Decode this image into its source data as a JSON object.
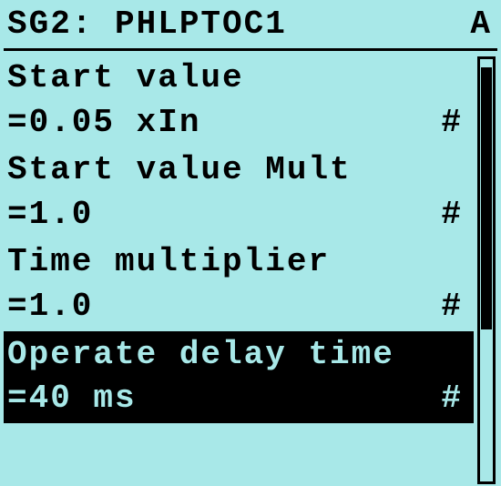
{
  "header": {
    "title": "SG2: PHLPTOC1",
    "status": "A"
  },
  "items": [
    {
      "label": "Start value",
      "value": "=0.05 xIn",
      "marker": "#",
      "selected": false
    },
    {
      "label": "Start value Mult",
      "value": "=1.0",
      "marker": "#",
      "selected": false
    },
    {
      "label": "Time multiplier",
      "value": "=1.0",
      "marker": "#",
      "selected": false
    },
    {
      "label": "Operate delay time",
      "value": "=40 ms",
      "marker": "#",
      "selected": true
    }
  ],
  "scrollbar": {
    "thumb_top_pct": 2,
    "thumb_height_pct": 62
  }
}
